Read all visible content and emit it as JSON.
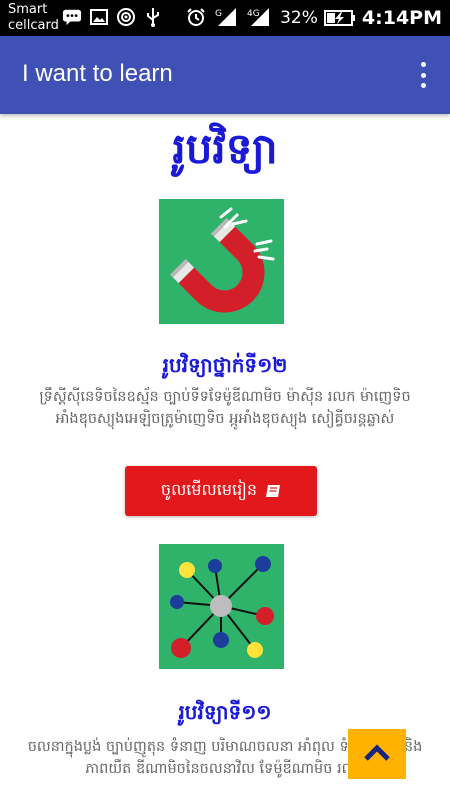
{
  "status_bar": {
    "carrier_line1": "Smart",
    "carrier_line2": "cellcard",
    "signal_g": "G",
    "signal_4g": "4G",
    "battery": "32%",
    "time": "4:14PM"
  },
  "app_bar": {
    "title": "I want to learn",
    "menu_icon": "overflow-menu-icon",
    "color": "#3f51b5"
  },
  "page": {
    "title": "រូបវិទ្យា"
  },
  "cards": [
    {
      "title": "រូបវិទ្យាថ្នាក់ទី១២",
      "description": "ទ្រឹស្ដីស៊ីនេទិចនៃឧស្ម័ន ច្បាប់ទីទទែម៉ូឌីណាមិច ម៉ាស៊ីន រលក ម៉ាញេទិច អាំងឌុចស្យុងអេឡិចត្រូម៉ាញេទិច អ្កូអាំងឌុចស្យុង សៀគ្វីចរន្តឆ្លាស់",
      "button_label": "ចូលមើលមេរៀន",
      "button_icon": "book-icon",
      "image_icon": "magnet-icon"
    },
    {
      "title": "រូបវិទ្យាទី១១",
      "description": "ចលនាក្នុងប្លង់ ច្បាប់ញូតុន ទំនាញ បរិមាណចលនា អាំពុល ទំនាញ និង និងភាពយឺត ឌីណាមិចនៃចលនាវិល ទែម៉ូឌីណាមិច រលក",
      "image_icon": "molecule-icon"
    }
  ],
  "fab": {
    "icon": "chevron-up-icon",
    "color": "#ffb300"
  },
  "colors": {
    "accent_blue": "#1a1ad6",
    "button_red": "#e3181b",
    "card_green": "#2fb36a"
  }
}
